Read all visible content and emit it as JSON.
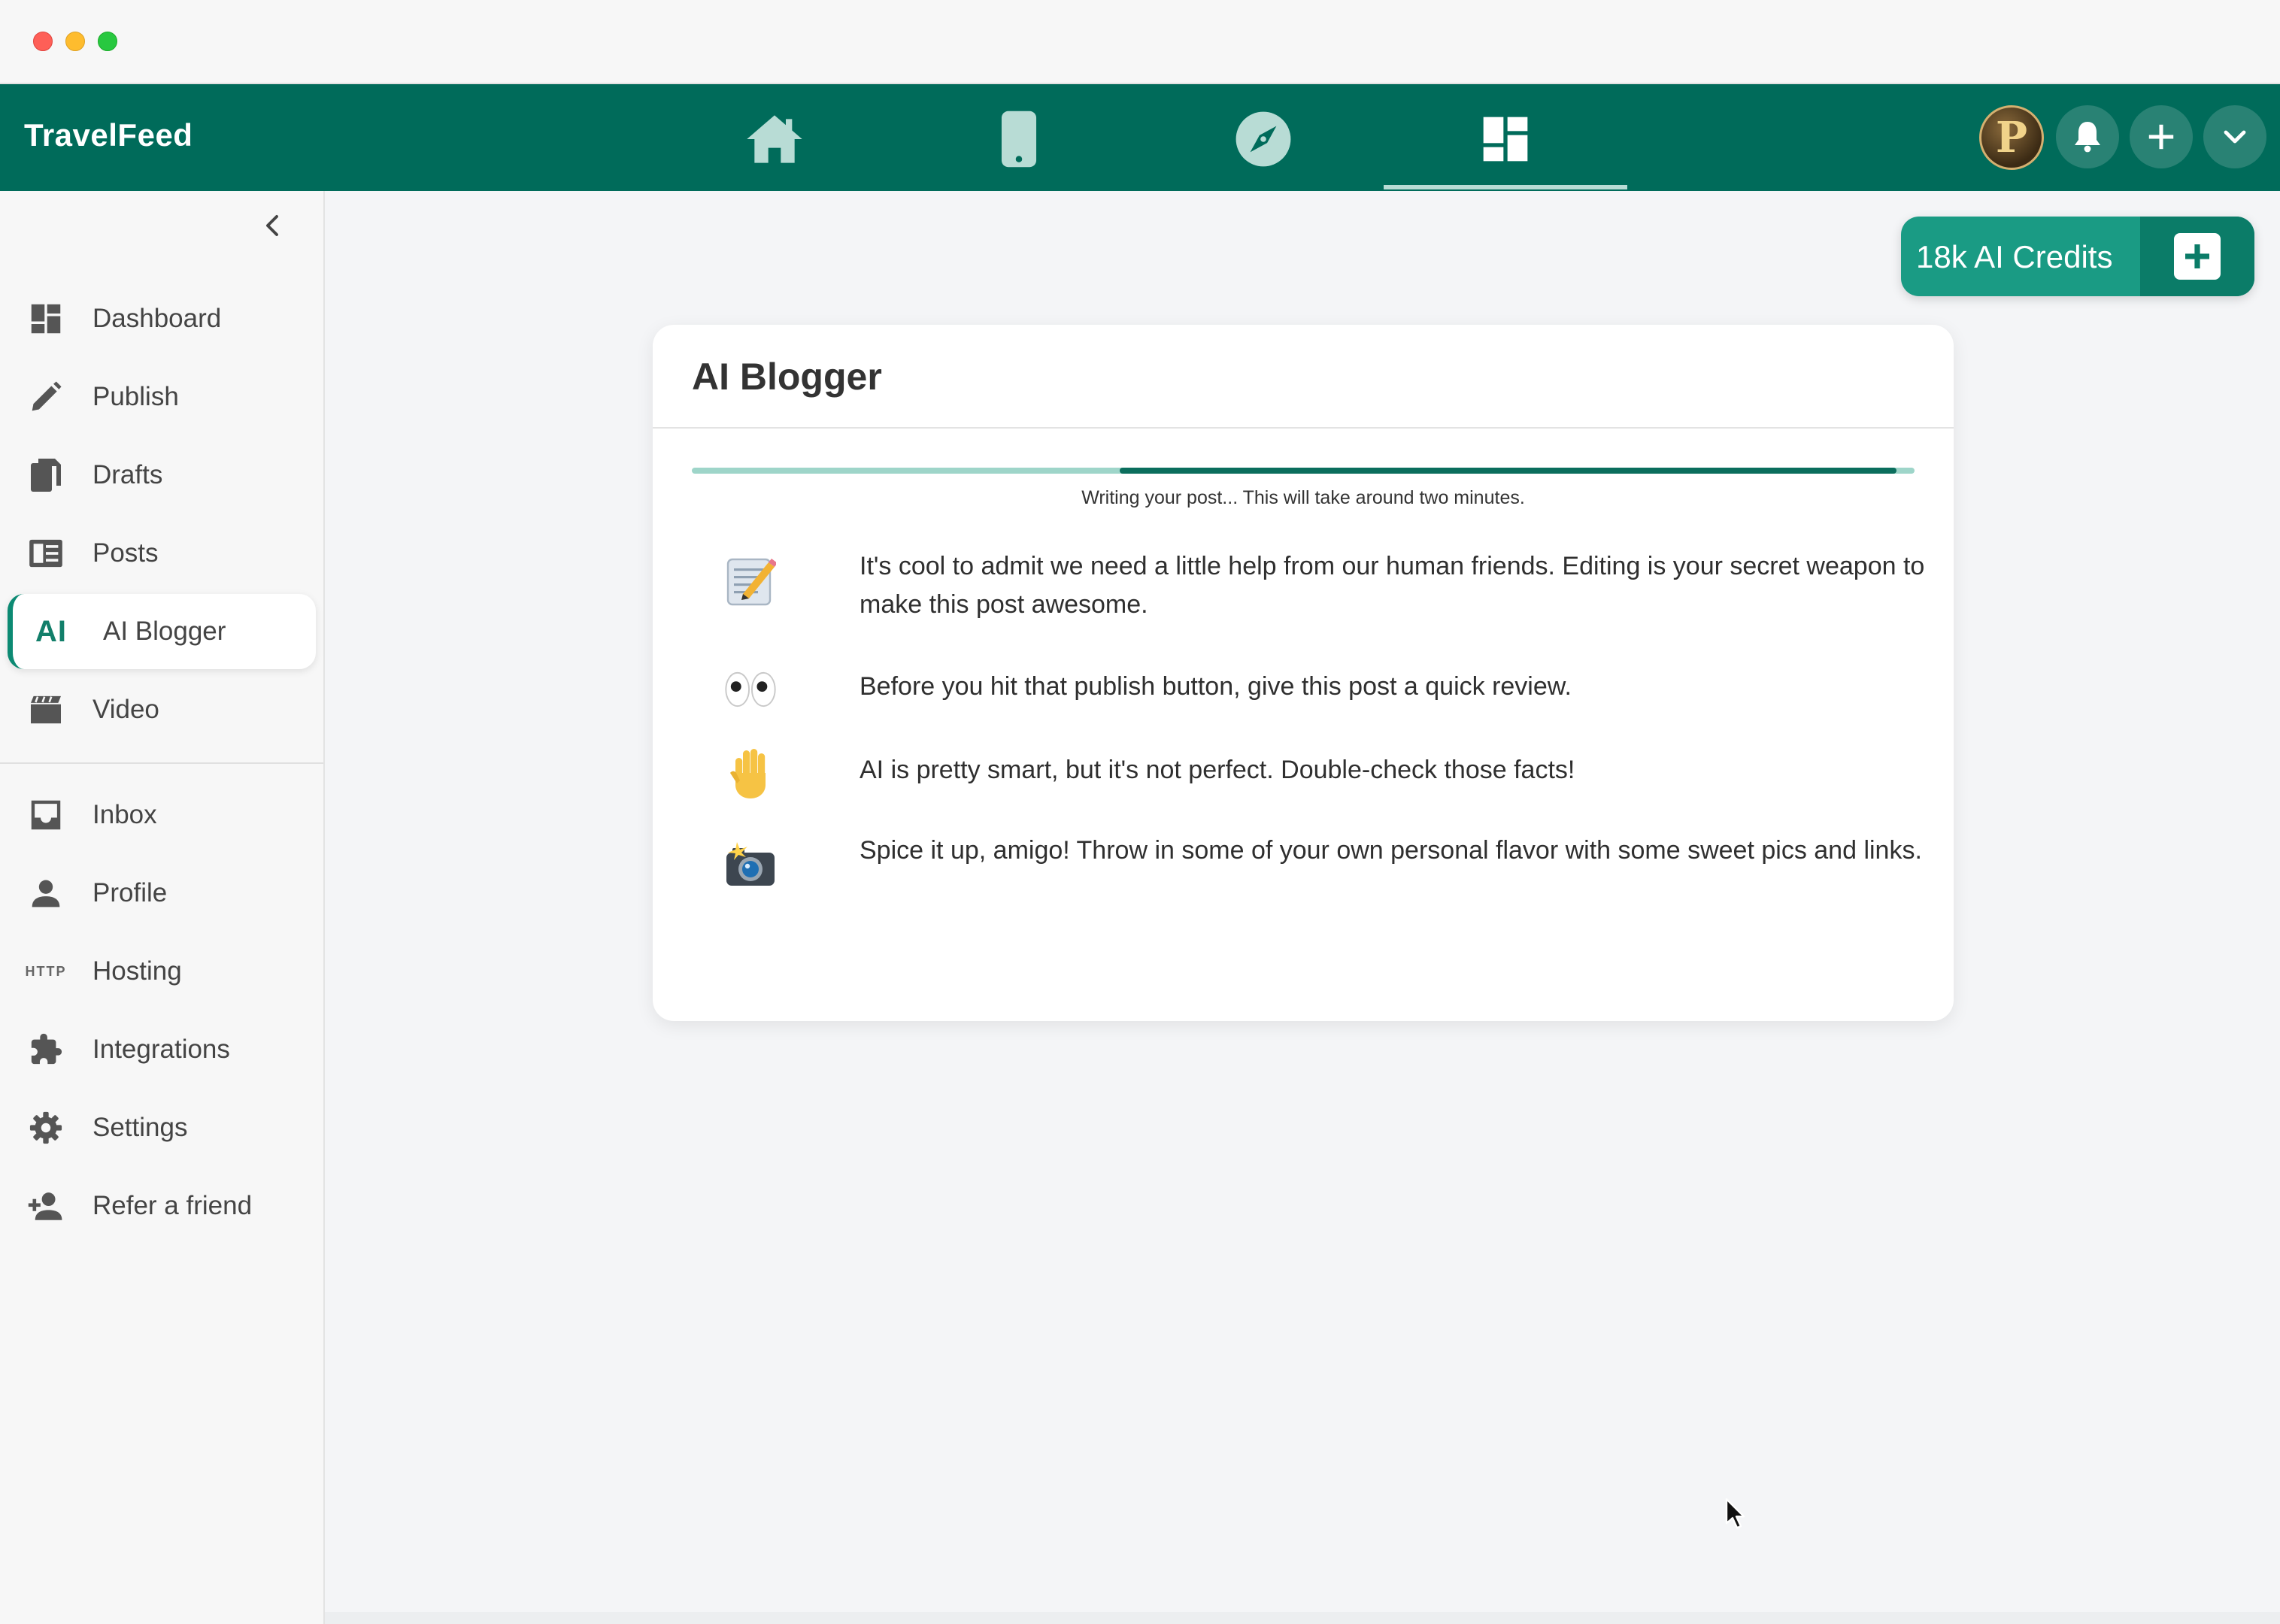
{
  "app": {
    "brand": "TravelFeed"
  },
  "colors": {
    "primary": "#006b5a",
    "accent": "#1a9b84",
    "progress_track": "#9ed5c9",
    "progress_fill": "#0b6e5d"
  },
  "topnav": {
    "icons": [
      "home-icon",
      "mobile-icon",
      "compass-icon",
      "dashboard-icon"
    ],
    "active": "dashboard-icon",
    "right_icons": [
      "avatar",
      "bell-icon",
      "plus-icon",
      "chevron-down-icon"
    ]
  },
  "sidebar": {
    "items": [
      {
        "label": "Dashboard",
        "icon": "dashboard-icon"
      },
      {
        "label": "Publish",
        "icon": "pencil-icon"
      },
      {
        "label": "Drafts",
        "icon": "drafts-icon"
      },
      {
        "label": "Posts",
        "icon": "posts-icon"
      },
      {
        "label": "AI Blogger",
        "icon": "ai-icon",
        "icon_text": "AI",
        "active": true
      },
      {
        "label": "Video",
        "icon": "video-icon"
      },
      {
        "label": "Inbox",
        "icon": "inbox-icon"
      },
      {
        "label": "Profile",
        "icon": "person-icon"
      },
      {
        "label": "Hosting",
        "icon": "http-icon",
        "icon_text": "HTTP"
      },
      {
        "label": "Integrations",
        "icon": "puzzle-icon"
      },
      {
        "label": "Settings",
        "icon": "gear-icon"
      },
      {
        "label": "Refer a friend",
        "icon": "add-person-icon"
      }
    ]
  },
  "credits": {
    "label": "18k AI Credits"
  },
  "card": {
    "title": "AI Blogger",
    "progress_fraction": 0.35,
    "progress_text": "Writing your post... This will take around two minutes.",
    "tips": [
      {
        "emoji": "memo-icon",
        "text": "It's cool to admit we need a little help from our human friends. Editing is your secret weapon to make this post awesome."
      },
      {
        "emoji": "eyes-icon",
        "text": "Before you hit that publish button, give this post a quick review."
      },
      {
        "emoji": "raised-hand-icon",
        "text": "AI is pretty smart, but it's not perfect. Double-check those facts!"
      },
      {
        "emoji": "camera-flash-icon",
        "text": "Spice it up, amigo! Throw in some of your own personal flavor with some sweet pics and links."
      }
    ]
  }
}
